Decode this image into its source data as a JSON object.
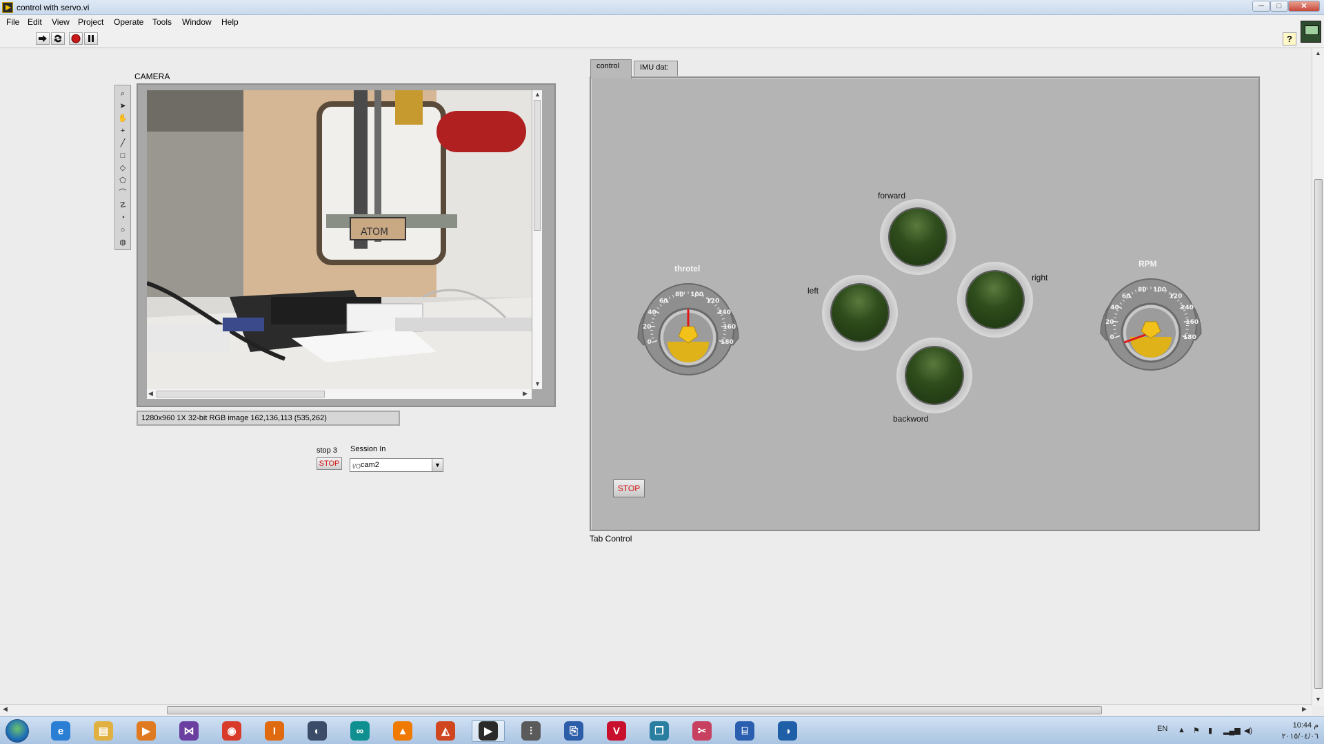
{
  "window": {
    "title": "control with servo.vi",
    "minimize": "─",
    "maximize": "□",
    "close": "✕"
  },
  "menu": [
    "File",
    "Edit",
    "View",
    "Project",
    "Operate",
    "Tools",
    "Window",
    "Help"
  ],
  "toolbar": {
    "run_icon": "run-arrow-icon",
    "run_continuous_icon": "run-continuously-icon",
    "abort_icon": "abort-icon",
    "pause_icon": "pause-icon",
    "help_label": "?"
  },
  "camera": {
    "label": "CAMERA",
    "status": "1280x960 1X 32-bit RGB image 162,136,113     (535,262)",
    "engraving": "ATOM",
    "tools": [
      "zoom-icon",
      "pointer-icon",
      "pan-hand-icon",
      "point-icon",
      "line-icon",
      "rectangle-icon",
      "rotated-rectangle-icon",
      "polygon-icon",
      "freehand-line-icon",
      "freehand-region-icon",
      "annulus-icon",
      "oval-icon",
      "broken-line-icon"
    ]
  },
  "stop3": {
    "label": "stop 3",
    "button": "STOP"
  },
  "session": {
    "label": "Session In",
    "value": "cam2",
    "icon_text": "I/O"
  },
  "tabs": [
    {
      "label": "control"
    },
    {
      "label": "IMU dat:"
    }
  ],
  "tab_caption": "Tab Control",
  "controls": {
    "throttle": {
      "label": "throtel",
      "ticks": [
        "0",
        "20",
        "40",
        "60",
        "80",
        "100",
        "120",
        "140",
        "160",
        "180"
      ],
      "value": 90
    },
    "rpm": {
      "label": "RPM",
      "ticks": [
        "0",
        "20",
        "40",
        "60",
        "80",
        "100",
        "120",
        "140",
        "160",
        "180"
      ],
      "value": 0
    },
    "leds": {
      "forward": "forward",
      "left": "left",
      "right": "right",
      "backword": "backword"
    },
    "stop_button": "STOP"
  },
  "taskbar": {
    "apps": [
      {
        "icon": "internet-explorer-icon",
        "glyph": "e",
        "color": "#2a7fd4"
      },
      {
        "icon": "file-explorer-icon",
        "glyph": "▤",
        "color": "#e0b040"
      },
      {
        "icon": "media-player-icon",
        "glyph": "▶",
        "color": "#e07a20"
      },
      {
        "icon": "visual-studio-icon",
        "glyph": "⋈",
        "color": "#6a3fa0"
      },
      {
        "icon": "chrome-icon",
        "glyph": "◉",
        "color": "#d83b2a"
      },
      {
        "icon": "installer-icon",
        "glyph": "I",
        "color": "#e06a10"
      },
      {
        "icon": "steam-icon",
        "glyph": "◐",
        "color": "#3a4c68"
      },
      {
        "icon": "arduino-icon",
        "glyph": "∞",
        "color": "#0f8f8f"
      },
      {
        "icon": "vlc-icon",
        "glyph": "▲",
        "color": "#f07a00"
      },
      {
        "icon": "matlab-icon",
        "glyph": "◭",
        "color": "#d0461e"
      },
      {
        "icon": "labview-icon",
        "glyph": "▶",
        "color": "#2a2a2a"
      },
      {
        "icon": "mixer-icon",
        "glyph": "⫶",
        "color": "#5a5a5a"
      },
      {
        "icon": "network-icon",
        "glyph": "⎘",
        "color": "#2c5da8"
      },
      {
        "icon": "visual-c-icon",
        "glyph": "V",
        "color": "#c8102e"
      },
      {
        "icon": "book-icon",
        "glyph": "❒",
        "color": "#2a7fa0"
      },
      {
        "icon": "paint-icon",
        "glyph": "✂",
        "color": "#c84060"
      },
      {
        "icon": "calculator-icon",
        "glyph": "⌸",
        "color": "#2a5fb0"
      },
      {
        "icon": "globe-app-icon",
        "glyph": "◑",
        "color": "#1f5fa8"
      }
    ],
    "lang": "EN",
    "tray_icons": [
      "show-hidden-icon",
      "flag-icon",
      "battery-icon",
      "signal-icon",
      "volume-icon"
    ],
    "time": "10:44 م",
    "date": "٢٠١٥/٠٤/٠٦"
  }
}
